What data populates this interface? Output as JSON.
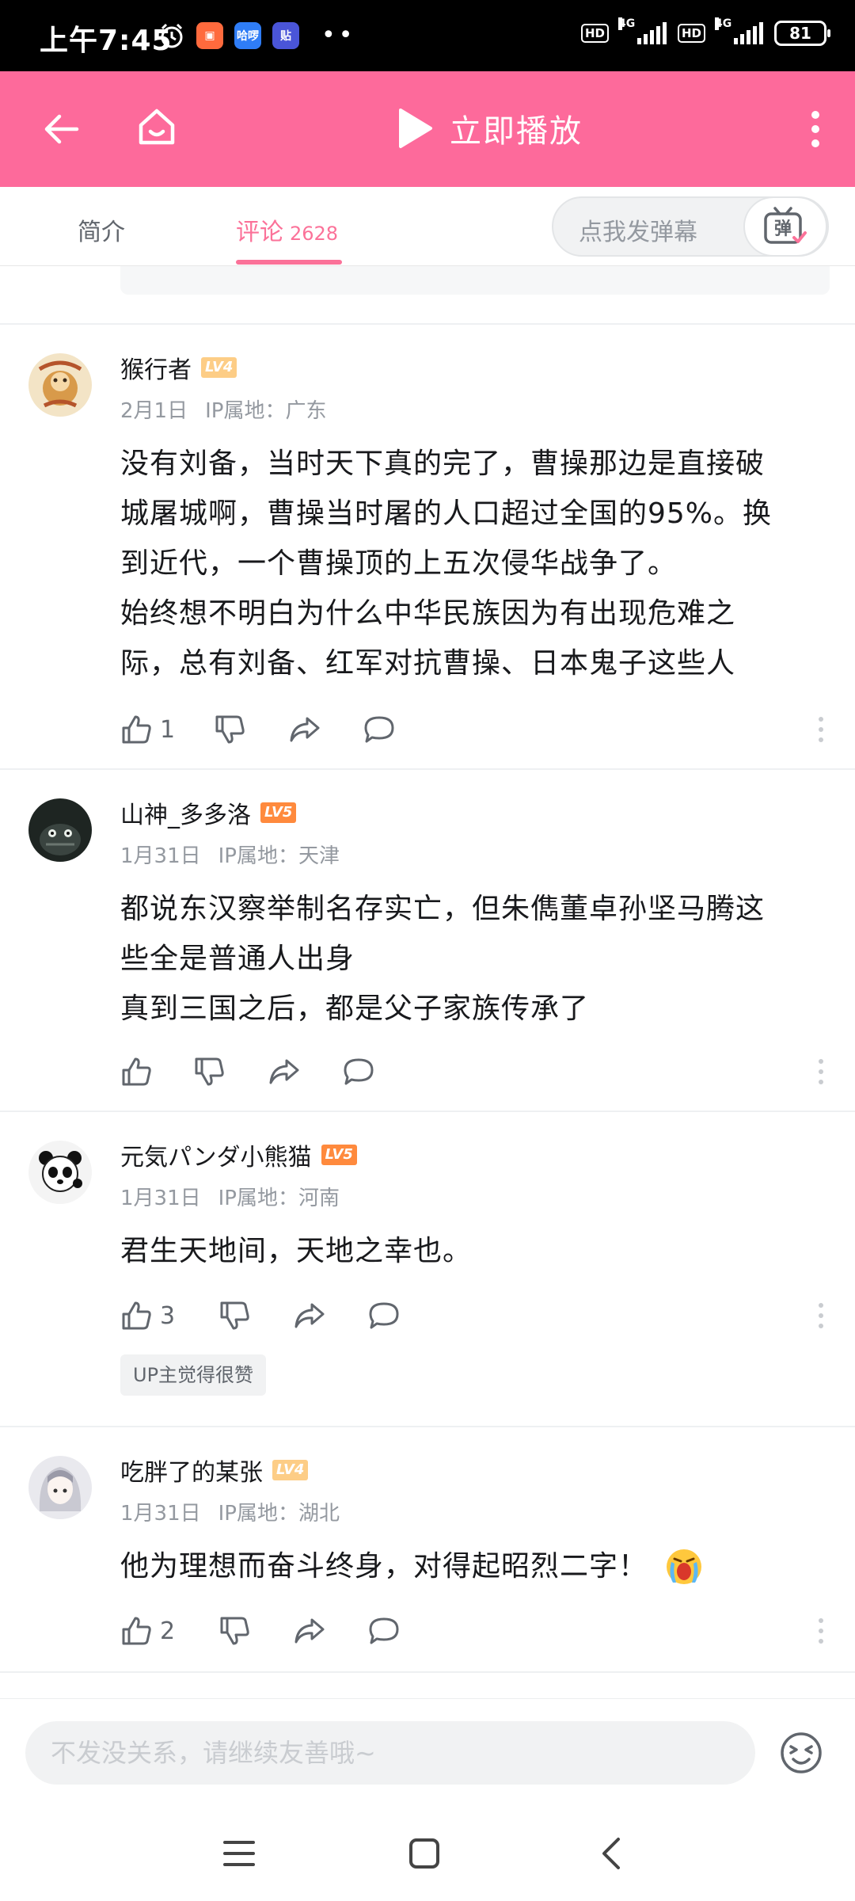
{
  "status_bar": {
    "time": "上午7:45",
    "app_badges": [
      "哈啰",
      "贴"
    ],
    "hd_badge": "HD",
    "network": "4G",
    "battery": "81"
  },
  "header": {
    "play_label": "立即播放",
    "accent_color": "#fd6a9b"
  },
  "tabs": {
    "intro": "简介",
    "comments": "评论",
    "comments_count": "2628",
    "danmaku_placeholder": "点我发弹幕",
    "danmaku_button": "弹"
  },
  "comments": [
    {
      "user": "猴行者",
      "level": "LV4",
      "date": "2月1日",
      "ip": "IP属地：广东",
      "lines": [
        "没有刘备，当时天下真的完了，曹操那边是直接破",
        "城屠城啊，曹操当时屠的人口超过全国的95%。换",
        "到近代，一个曹操顶的上五次侵华战争了。",
        "始终想不明白为什么中华民族因为有出现危难之",
        "际，总有刘备、红军对抗曹操、日本鬼子这些人"
      ],
      "likes": "1"
    },
    {
      "user": "山神_多多洛",
      "level": "LV5",
      "date": "1月31日",
      "ip": "IP属地：天津",
      "lines": [
        "都说东汉察举制名存实亡，但朱儁董卓孙坚马腾这",
        "些全是普通人出身",
        "真到三国之后，都是父子家族传承了"
      ],
      "likes": ""
    },
    {
      "user": "元気パンダ小熊猫",
      "level": "LV5",
      "date": "1月31日",
      "ip": "IP属地：河南",
      "lines": [
        "君生天地间，天地之幸也。"
      ],
      "likes": "3",
      "badge": "UP主觉得很赞"
    },
    {
      "user": "吃胖了的某张",
      "level": "LV4",
      "date": "1月31日",
      "ip": "IP属地：湖北",
      "lines": [
        "他为理想而奋斗终身，对得起昭烈二字！"
      ],
      "likes": "2"
    }
  ],
  "reply_bar": {
    "placeholder": "不发没关系，请继续友善哦~"
  }
}
